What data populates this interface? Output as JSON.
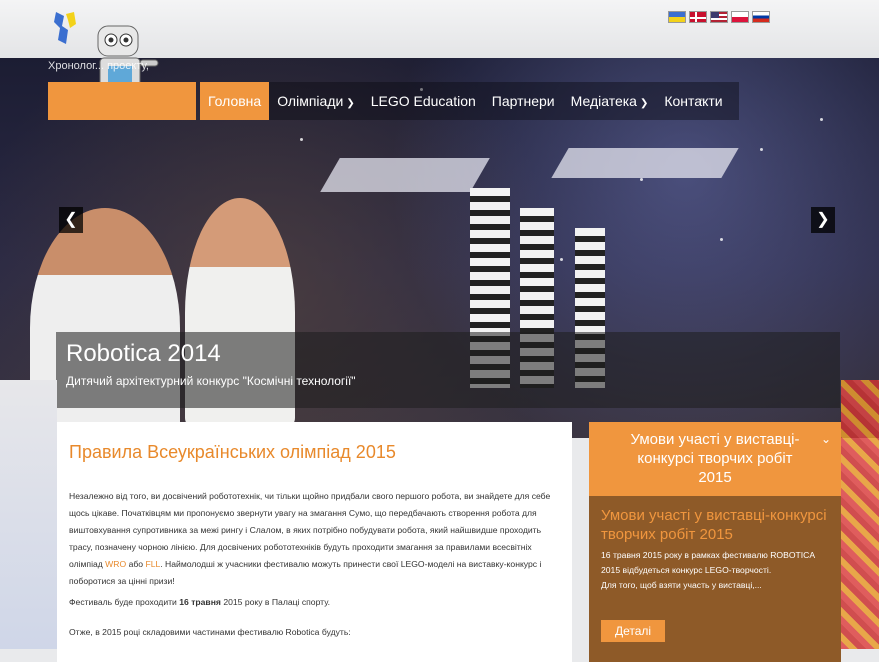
{
  "flags": [
    "flag-ua",
    "flag-dk",
    "flag-us",
    "flag-pl",
    "flag-ru"
  ],
  "logo": {
    "tagline": "Хронолог... проекту,"
  },
  "nav": {
    "items": [
      {
        "label": "Головна",
        "active": true
      },
      {
        "label": "Олімпіади",
        "caret": true
      },
      {
        "label": "LEGO Education"
      },
      {
        "label": "Партнери"
      },
      {
        "label": "Медіатека",
        "caret": true
      },
      {
        "label": "Контакти"
      }
    ]
  },
  "slider": {
    "prev_icon": "chevron-left-icon",
    "next_icon": "chevron-right-icon",
    "title": "Robotica 2014",
    "subtitle": "Дитячий архітектурний конкурс \"Космічні технології\""
  },
  "article": {
    "title_part1": "Правила ",
    "title_part2": "Всеукраїнських олімпіад 2015",
    "p1_a": "Незалежно від того, ви досвічений робототехнік, чи тільки щойно придбали свого першого робота, ви знайдете для себе щось цікаве. Початківцям ми пропонуємо звернути увагу на змагання Сумо, що передбачають створення робота для виштовхування супротивника за межі рингу і Слалом, в яких потрібно побудувати робота, який найшвидше проходить трасу, позначену чорною лінією. Для досвічених робототехніків будуть проходити змагання за правилами всесвітніх олімпіад ",
    "p1_wro": "WRO",
    "p1_b": " або ",
    "p1_fll": "FLL",
    "p1_c": ". Наймолодші ж учасники фестивалю можуть принести свої LEGO-моделі на виставку-конкурс і поборотися за цінні призи!",
    "p2_a": "Фестиваль буде проходити ",
    "p2_date": "16 травня",
    "p2_b": " 2015 року в Палаці спорту.",
    "p3": "Отже, в 2015 році складовими частинами фестивалю Robotica будуть:"
  },
  "sidebar": {
    "header": "Умови участі у виставці-конкурсі творчих робіт 2015",
    "title": "Умови участі у виставці-конкурсі творчих робіт 2015",
    "text_1": "16 травня 2015 року в рамках фестивалю ROBOTICA 2015 відбудеться конкурс LEGO-творчості.",
    "text_2": "Для того, щоб взяти участь у виставці,...",
    "button": "Деталі"
  },
  "colors": {
    "accent": "#f0963e",
    "accent_text": "#e8892b",
    "sidebar_bg": "#8e5a28"
  }
}
